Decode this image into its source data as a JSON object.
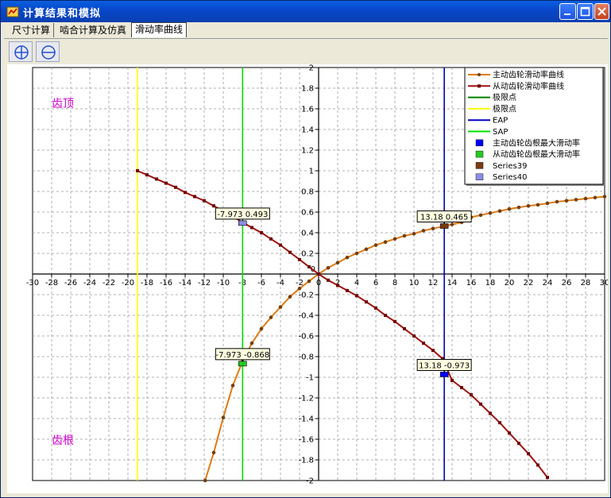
{
  "window": {
    "title": "计算结果和模拟"
  },
  "tabs": [
    {
      "label": "尺寸计算"
    },
    {
      "label": "啮合计算及仿真"
    },
    {
      "label": "滑动率曲线"
    }
  ],
  "colors": {
    "driving": "#e07a10",
    "driven": "#a01010",
    "limit_green": "#008000",
    "limit_yellow": "#ffff00",
    "eap": "#0000c0",
    "sap": "#00e000",
    "pt_blue": "#0000ff",
    "pt_green": "#22cc22",
    "pt_brown": "#7a3a10",
    "pt_lavender": "#8c8ce6",
    "region_text": "#d000d0"
  },
  "chart_data": {
    "type": "line",
    "xlim": [
      -30,
      30
    ],
    "ylim": [
      -2,
      2
    ],
    "xticks": [
      -30,
      -28,
      -26,
      -24,
      -22,
      -20,
      -18,
      -16,
      -14,
      -12,
      -10,
      -8,
      -6,
      -4,
      -2,
      0,
      2,
      4,
      6,
      8,
      10,
      12,
      14,
      16,
      18,
      20,
      22,
      24,
      26,
      28,
      30
    ],
    "yticks": [
      -2,
      -1.8,
      -1.6,
      -1.4,
      -1.2,
      -1,
      -0.8,
      -0.6,
      -0.4,
      -0.2,
      0,
      0.2,
      0.4,
      0.6,
      0.8,
      1,
      1.2,
      1.4,
      1.6,
      1.8,
      2
    ],
    "grid": true,
    "legend_position": "top-right",
    "annotations_top": "齿顶",
    "annotations_bottom": "齿根",
    "series": [
      {
        "name": "主动齿轮滑动率曲线",
        "x": [
          -11.9,
          -11.0,
          -10.0,
          -9.0,
          -8.0,
          -7.0,
          -6.0,
          -5.0,
          -4.0,
          -3.0,
          -2.0,
          -1.0,
          0,
          1,
          2,
          3,
          4,
          5,
          6,
          7,
          8,
          9,
          10,
          11,
          12,
          13,
          14,
          15,
          16,
          17,
          18,
          19,
          20,
          21,
          22,
          23,
          24,
          25,
          26,
          27,
          28,
          29,
          30
        ],
        "y": [
          -2.0,
          -1.73,
          -1.39,
          -1.08,
          -0.85,
          -0.67,
          -0.53,
          -0.42,
          -0.32,
          -0.22,
          -0.14,
          -0.07,
          0,
          0.06,
          0.11,
          0.16,
          0.2,
          0.24,
          0.28,
          0.31,
          0.34,
          0.37,
          0.39,
          0.42,
          0.44,
          0.46,
          0.48,
          0.5,
          0.55,
          0.57,
          0.59,
          0.61,
          0.63,
          0.645,
          0.66,
          0.67,
          0.685,
          0.7,
          0.71,
          0.72,
          0.73,
          0.74,
          0.75
        ]
      },
      {
        "name": "从动齿轮滑动率曲线",
        "x": [
          -19.0,
          -18,
          -17,
          -16,
          -15,
          -14,
          -13,
          -12,
          -11,
          -10,
          -9,
          -8,
          -7,
          -6,
          -5,
          -4,
          -3,
          -2,
          -1,
          0,
          1,
          2,
          3,
          4,
          5,
          6,
          7,
          8,
          9,
          10,
          11,
          12,
          13,
          14,
          15,
          16,
          17,
          18,
          19,
          20,
          21,
          22,
          23,
          24
        ],
        "y": [
          1.0,
          0.96,
          0.92,
          0.88,
          0.84,
          0.79,
          0.75,
          0.71,
          0.66,
          0.61,
          0.56,
          0.5,
          0.45,
          0.4,
          0.34,
          0.28,
          0.21,
          0.14,
          0.07,
          0,
          -0.06,
          -0.11,
          -0.16,
          -0.21,
          -0.27,
          -0.33,
          -0.4,
          -0.46,
          -0.53,
          -0.6,
          -0.67,
          -0.74,
          -0.82,
          -1.03,
          -1.1,
          -1.17,
          -1.26,
          -1.35,
          -1.44,
          -1.54,
          -1.64,
          -1.74,
          -1.85,
          -1.97
        ]
      }
    ],
    "vlines": [
      {
        "name": "极限点",
        "x": -19.0
      },
      {
        "name": "EAP",
        "x": 13.18
      },
      {
        "name": "SAP",
        "x": -7.973
      }
    ],
    "legend": [
      {
        "label": "主动齿轮滑动率曲线",
        "kind": "line-marker",
        "color": "driving"
      },
      {
        "label": "从动齿轮滑动率曲线",
        "kind": "line-marker",
        "color": "driven"
      },
      {
        "label": "极限点",
        "kind": "line",
        "color": "limit_green"
      },
      {
        "label": "极限点",
        "kind": "line",
        "color": "limit_yellow"
      },
      {
        "label": "EAP",
        "kind": "line",
        "color": "eap"
      },
      {
        "label": "SAP",
        "kind": "line",
        "color": "sap"
      },
      {
        "label": "主动齿轮齿根最大滑动率",
        "kind": "square",
        "color": "pt_blue"
      },
      {
        "label": "从动齿轮齿根最大滑动率",
        "kind": "square",
        "color": "pt_green"
      },
      {
        "label": "Series39",
        "kind": "square",
        "color": "pt_brown"
      },
      {
        "label": "Series40",
        "kind": "square",
        "color": "pt_lavender"
      }
    ],
    "points": [
      {
        "x": -7.973,
        "y": 0.493,
        "label": "-7.973 0.493",
        "color": "pt_lavender"
      },
      {
        "x": -7.973,
        "y": -0.868,
        "label": "-7.973 -0.868",
        "color": "pt_green"
      },
      {
        "x": 13.18,
        "y": 0.465,
        "label": "13.18 0.465",
        "color": "pt_brown"
      },
      {
        "x": 13.18,
        "y": -0.973,
        "label": "13.18 -0.973",
        "color": "pt_blue"
      }
    ]
  }
}
